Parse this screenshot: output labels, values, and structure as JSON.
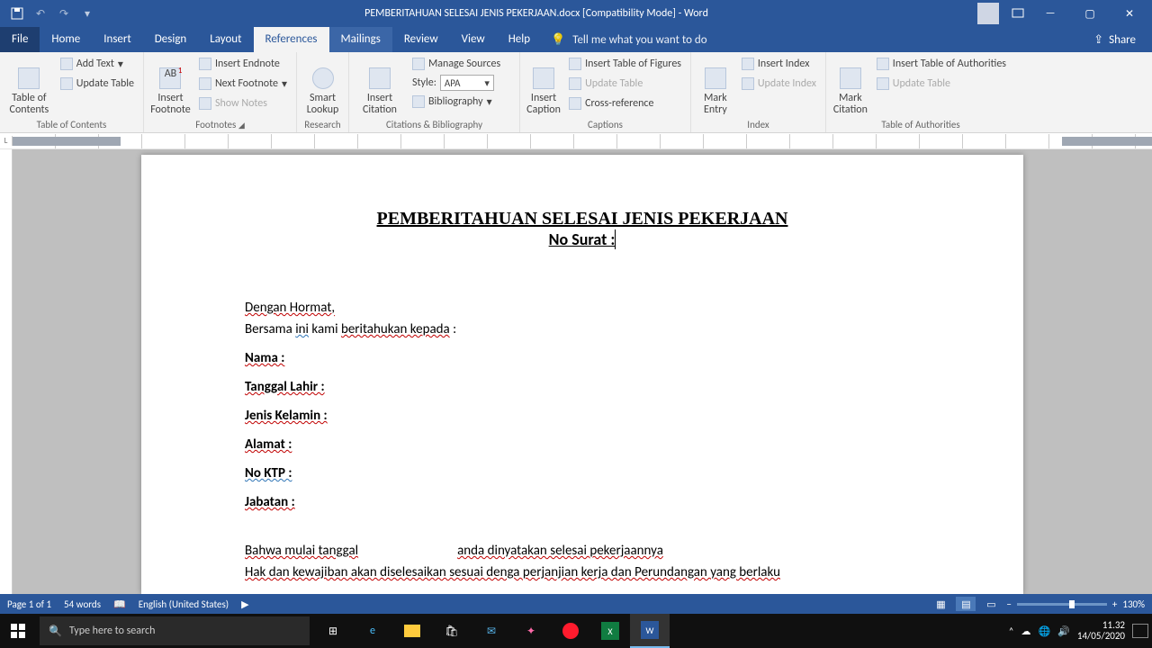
{
  "title": "PEMBERITAHUAN SELESAI JENIS PEKERJAAN.docx  [Compatibility Mode]  -  Word",
  "menus": {
    "file": "File",
    "home": "Home",
    "insert": "Insert",
    "design": "Design",
    "layout": "Layout",
    "references": "References",
    "mailings": "Mailings",
    "review": "Review",
    "view": "View",
    "help": "Help",
    "tell": "Tell me what you want to do",
    "share": "Share"
  },
  "ribbon": {
    "toc": {
      "big": "Table of\nContents",
      "add": "Add Text",
      "update": "Update Table",
      "label": "Table of Contents"
    },
    "fn": {
      "big": "Insert\nFootnote",
      "end": "Insert Endnote",
      "next": "Next Footnote",
      "show": "Show Notes",
      "label": "Footnotes"
    },
    "research": {
      "big": "Smart\nLookup",
      "label": "Research"
    },
    "cit": {
      "big": "Insert\nCitation",
      "manage": "Manage Sources",
      "style": "Style:",
      "styleval": "APA",
      "bib": "Bibliography",
      "label": "Citations & Bibliography"
    },
    "cap": {
      "big": "Insert\nCaption",
      "tof": "Insert Table of Figures",
      "update": "Update Table",
      "cross": "Cross-reference",
      "label": "Captions"
    },
    "idx": {
      "big": "Mark\nEntry",
      "ins": "Insert Index",
      "update": "Update Index",
      "label": "Index"
    },
    "toa": {
      "big": "Mark\nCitation",
      "ins": "Insert Table of Authorities",
      "update": "Update Table",
      "label": "Table of Authorities"
    }
  },
  "doc": {
    "title": "PEMBERITAHUAN SELESAI JENIS PEKERJAAN",
    "sub": "No Surat :",
    "greet": "Dengan Hormat,",
    "line2a": "Bersama ",
    "line2b": "ini",
    "line2c": " kami ",
    "line2d": "beritahukan kepada",
    " line2e": " :",
    "f1": "Nama :",
    "f2": "Tanggal  Lahir :",
    "f3": "Jenis Kelamin :",
    "f4": "Alamat :",
    "f5": "No KTP :",
    "f6": "Jabatan :",
    "p1a": "Bahwa mulai tanggal",
    "p1b": "anda dinyatakan selesai pekerjaannya",
    "p2": "Hak dan kewajiban akan diselesaikan sesuai denga perjanjian kerja dan Perundangan yang berlaku"
  },
  "status": {
    "page": "Page 1 of 1",
    "words": "54 words",
    "lang": "English (United States)",
    "zoom": "130%"
  },
  "taskbar": {
    "search": "Type here to search",
    "time": "11.32",
    "date": "14/05/2020"
  }
}
